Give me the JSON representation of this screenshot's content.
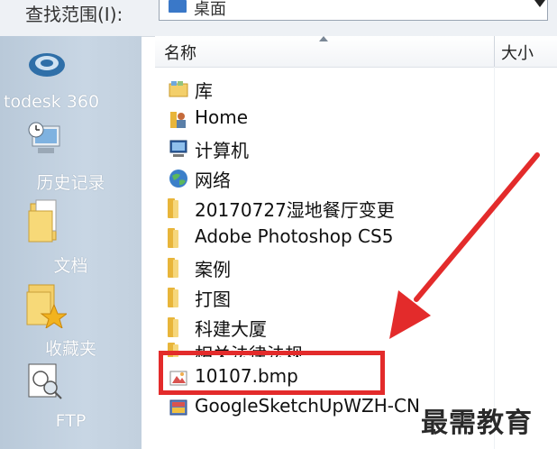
{
  "lookin": {
    "label": "查找范围(I):",
    "value": "桌面"
  },
  "header": {
    "name": "名称",
    "size": "大小"
  },
  "places": [
    {
      "label": "todesk 360",
      "icon": "autodesk-360-icon"
    },
    {
      "label": "历史记录",
      "icon": "history-icon"
    },
    {
      "label": "文档",
      "icon": "documents-folder-icon"
    },
    {
      "label": "收藏夹",
      "icon": "favorites-folder-icon"
    },
    {
      "label": "FTP",
      "icon": "ftp-icon"
    }
  ],
  "files": [
    {
      "name": "库",
      "icon": "library-icon"
    },
    {
      "name": "Home",
      "icon": "home-folder-icon"
    },
    {
      "name": "计算机",
      "icon": "computer-icon"
    },
    {
      "name": "网络",
      "icon": "network-icon"
    },
    {
      "name": "20170727湿地餐厅变更",
      "icon": "folder-icon"
    },
    {
      "name": "Adobe Photoshop CS5",
      "icon": "folder-icon"
    },
    {
      "name": "案例",
      "icon": "folder-icon"
    },
    {
      "name": "打图",
      "icon": "folder-icon"
    },
    {
      "name": "科建大厦",
      "icon": "folder-icon"
    },
    {
      "name": "相关法律法规",
      "icon": "folder-icon"
    },
    {
      "name": "10107.bmp",
      "icon": "bmp-file-icon"
    },
    {
      "name": "GoogleSketchUpWZH-CN",
      "icon": "installer-icon"
    }
  ],
  "watermark": "最需教育",
  "colors": {
    "highlight": "#e32b2b",
    "folder": "#e8b53a",
    "places_bg": "#c2d0de"
  }
}
